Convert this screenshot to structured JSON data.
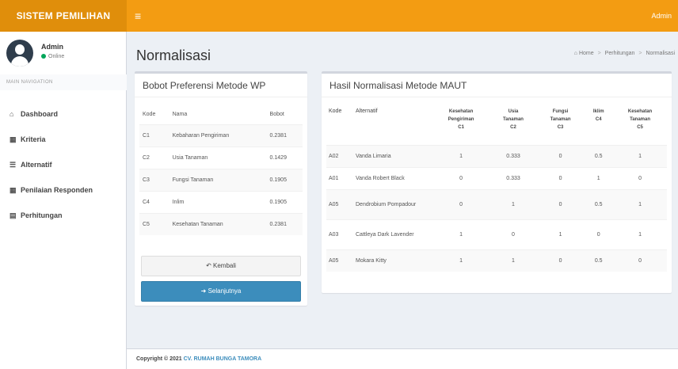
{
  "header": {
    "brand": "SISTEM PEMILIHAN",
    "menu_icon": "≡",
    "user": "Admin"
  },
  "sidebar": {
    "user_name": "Admin",
    "user_status": "Online",
    "nav_header": "MAIN NAVIGATION",
    "items": [
      {
        "icon": "home-icon",
        "glyph": "⌂",
        "label": "Dashboard"
      },
      {
        "icon": "grid-icon",
        "glyph": "▦",
        "label": "Kriteria"
      },
      {
        "icon": "list-icon",
        "glyph": "☰",
        "label": "Alternatif"
      },
      {
        "icon": "table-icon",
        "glyph": "▦",
        "label": "Penilaian Responden"
      },
      {
        "icon": "calculator-icon",
        "glyph": "▤",
        "label": "Perhitungan"
      }
    ]
  },
  "page": {
    "title": "Normalisasi",
    "breadcrumb": [
      "Home",
      "Perhitungan",
      "Normalisasi"
    ]
  },
  "left_box": {
    "title": "Bobot Preferensi Metode WP",
    "headers": [
      "Kode",
      "Nama",
      "Bobot"
    ],
    "rows": [
      [
        "C1",
        "Kebaharan Pengiriman",
        "0.2381"
      ],
      [
        "C2",
        "Usia Tanaman",
        "0.1429"
      ],
      [
        "C3",
        "Fungsi Tanaman",
        "0.1905"
      ],
      [
        "C4",
        "Inlim",
        "0.1905"
      ],
      [
        "C5",
        "Kesehatan Tanaman",
        "0.2381"
      ]
    ],
    "back_label": "Kembali",
    "next_label": "Selanjutnya"
  },
  "right_box": {
    "title": "Hasil Normalisasi Metode MAUT",
    "headers": [
      {
        "line1": "Kode",
        "line2": "",
        "line3": ""
      },
      {
        "line1": "Alternatif",
        "line2": "",
        "line3": ""
      },
      {
        "line1": "Kesehatan",
        "line2": "Pengiriman",
        "line3": "C1"
      },
      {
        "line1": "Usia",
        "line2": "Tanaman",
        "line3": "C2"
      },
      {
        "line1": "Fungsi",
        "line2": "Tanaman",
        "line3": "C3"
      },
      {
        "line1": "Iklim",
        "line2": "C4",
        "line3": ""
      },
      {
        "line1": "Kesehatan",
        "line2": "Tanaman",
        "line3": "C5"
      }
    ],
    "rows": [
      [
        "A02",
        "Vanda Limaria",
        "1",
        "0.333",
        "0",
        "0.5",
        "1"
      ],
      [
        "A01",
        "Vanda Robert Black",
        "0",
        "0.333",
        "0",
        "1",
        "0"
      ],
      [
        "A05",
        "Dendrobium Pompadour",
        "0",
        "1",
        "0",
        "0.5",
        "1"
      ],
      [
        "A03",
        "Cattleya Dark Lavender",
        "1",
        "0",
        "1",
        "0",
        "1"
      ],
      [
        "A05",
        "Mokara Kitty",
        "1",
        "1",
        "0",
        "0.5",
        "0"
      ]
    ]
  },
  "footer": {
    "copyright": "Copyright © 2021",
    "company": "CV. RUMAH BUNGA TAMORA"
  }
}
